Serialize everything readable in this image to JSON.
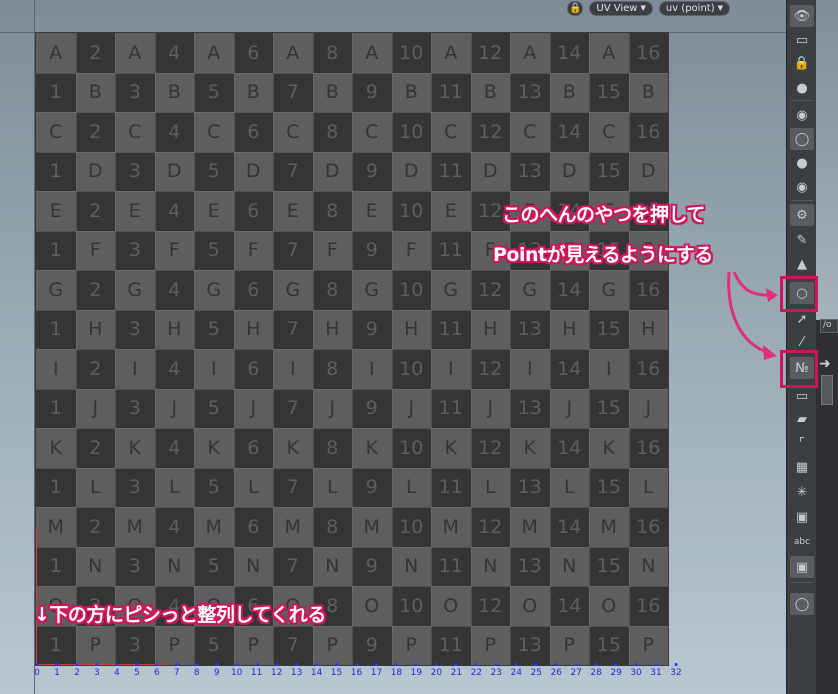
{
  "viewport": {
    "grid": {
      "letters": [
        "A",
        "B",
        "C",
        "D",
        "E",
        "F",
        "G",
        "H",
        "I",
        "J",
        "K",
        "L",
        "M",
        "N",
        "O",
        "P"
      ],
      "columns": 16
    },
    "axis_ticks": [
      "0",
      "1",
      "2",
      "3",
      "4",
      "5",
      "6",
      "7",
      "8",
      "9",
      "10",
      "11",
      "12",
      "13",
      "14",
      "15",
      "16",
      "17",
      "18",
      "19",
      "20",
      "21",
      "22",
      "23",
      "24",
      "25",
      "26",
      "27",
      "28",
      "29",
      "30",
      "31",
      "32"
    ]
  },
  "view_controls": {
    "view_label": "UV View",
    "mode_label": "uv (point)"
  },
  "side_panel": {
    "tab_label": "/o"
  },
  "toolbar": {
    "abc_label": "abc"
  },
  "annotations": {
    "line1": "このへんのやつを押して",
    "line2": "Pointが見えるようにする",
    "bottom": "↓下の方にピシっと整列してくれる"
  },
  "colors": {
    "annotation_fill": "#ffffff",
    "annotation_outline": "#d0145c",
    "highlight_box": "#d0145c",
    "arrow": "#e0307a",
    "axis_label": "#1f2ad8",
    "grid_light": "#5e5e5e",
    "grid_dark": "#353535"
  }
}
